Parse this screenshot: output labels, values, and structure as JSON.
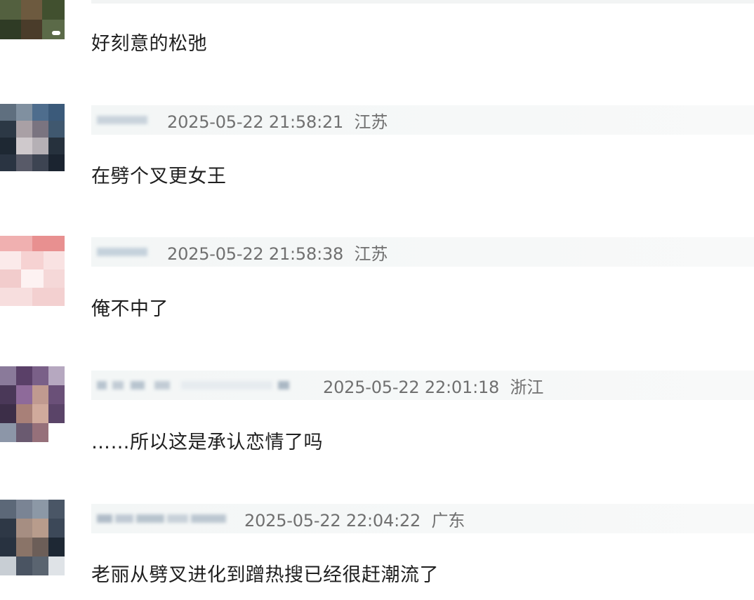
{
  "comments": [
    {
      "text": "好刻意的松弛"
    },
    {
      "timestamp": "2025-05-22 21:58:21",
      "location": "江苏",
      "text": "在劈个叉更女王"
    },
    {
      "timestamp": "2025-05-22 21:58:38",
      "location": "江苏",
      "text": "俺不中了"
    },
    {
      "timestamp": "2025-05-22 22:01:18",
      "location": "浙江",
      "text": "……所以这是承认恋情了吗"
    },
    {
      "timestamp": "2025-05-22 22:04:22",
      "location": "广东",
      "text": "老丽从劈叉进化到蹭热搜已经很赶潮流了"
    }
  ],
  "colors": {
    "comment_text": "#1f1f1f",
    "meta_text": "#707070",
    "meta_bar": "#f4f6f6"
  }
}
